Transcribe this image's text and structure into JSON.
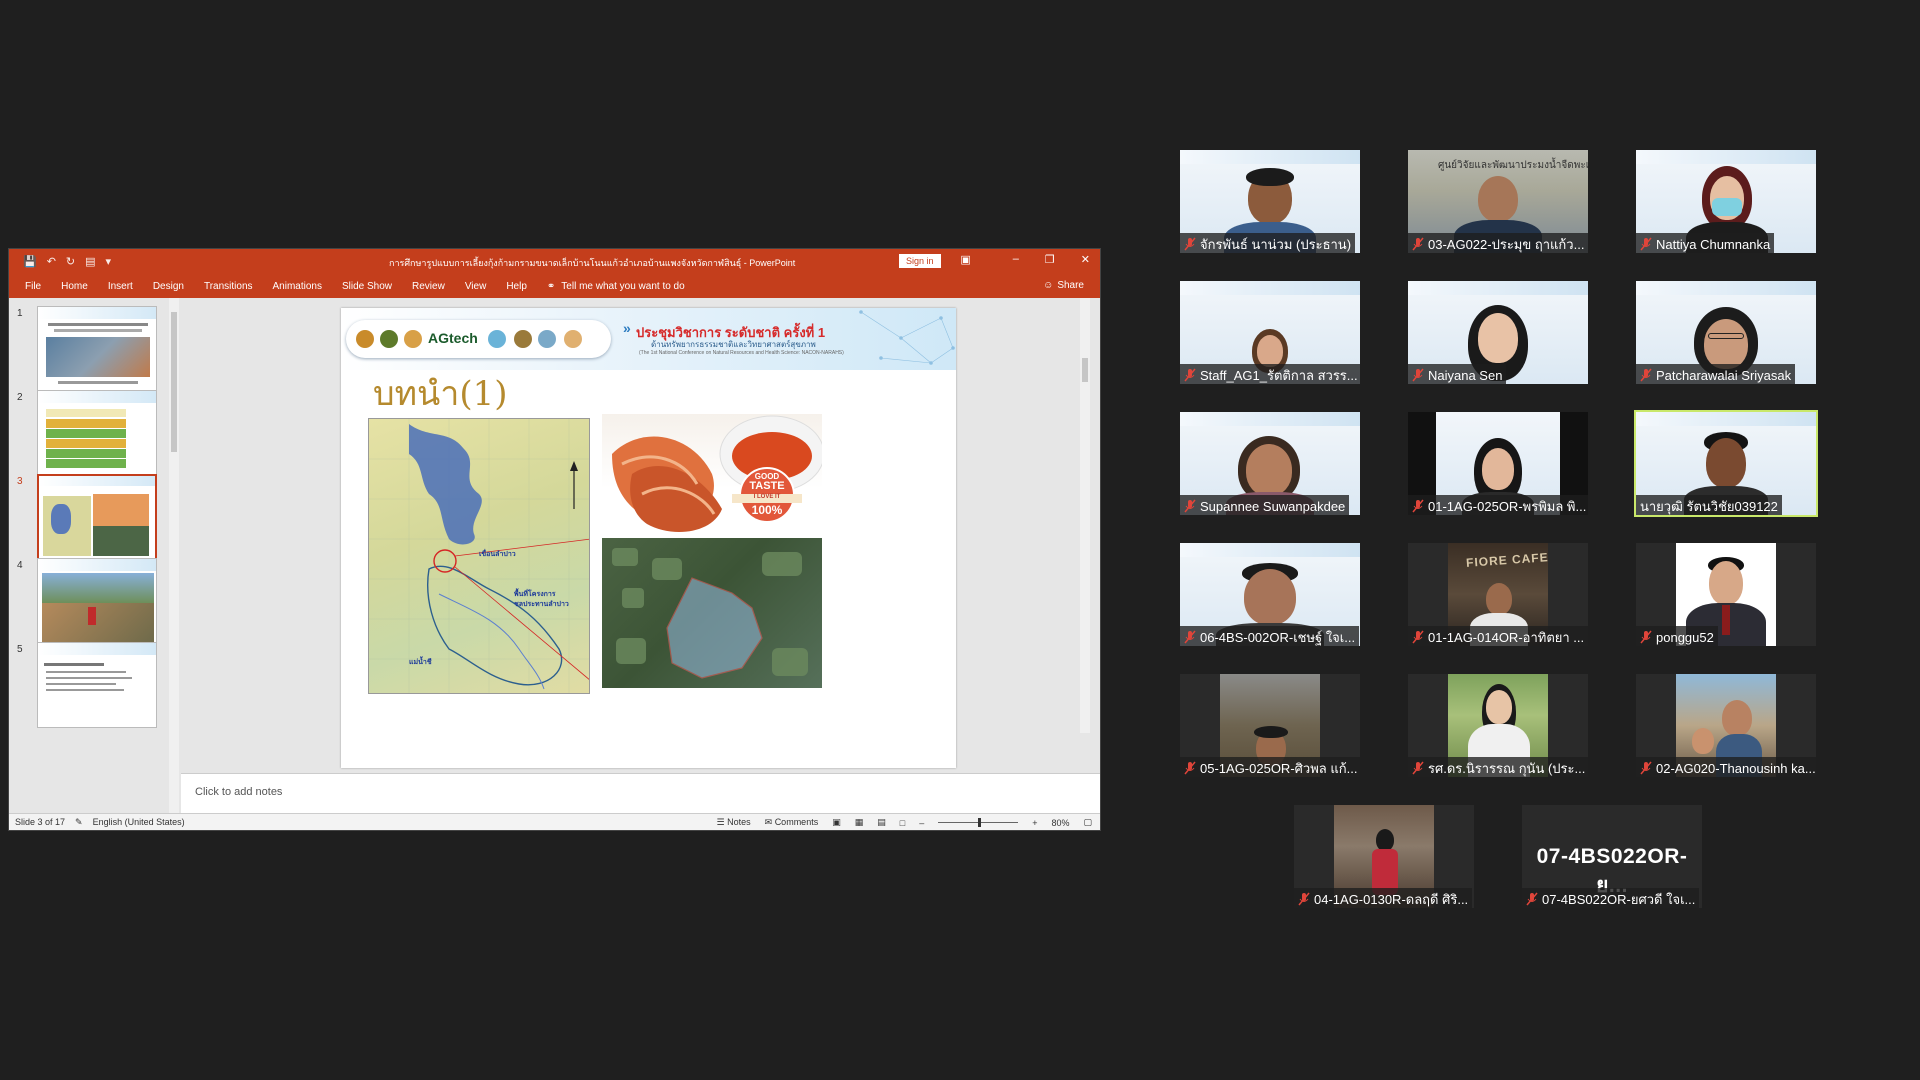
{
  "powerpoint": {
    "doc_title": "การศึกษารูปแบบการเลี้ยงกุ้งก้ามกรามขนาดเล็กบ้านโนนแก้วอำเภอบ้านแพงจังหวัดกาฬสินธุ์ - PowerPoint",
    "sign_in": "Sign in",
    "tabs": [
      "File",
      "Home",
      "Insert",
      "Design",
      "Transitions",
      "Animations",
      "Slide Show",
      "Review",
      "View",
      "Help"
    ],
    "tell_me": "Tell me what you want to do",
    "share": "Share",
    "thumbnail_numbers": [
      "1",
      "2",
      "3",
      "4",
      "5"
    ],
    "current_slide_index": 3,
    "notes_placeholder": "Click to add notes",
    "status": {
      "slide_counter": "Slide 3 of 17",
      "language": "English (United States)",
      "notes": "Notes",
      "comments": "Comments",
      "zoom": "80%"
    },
    "slide": {
      "conference_title": "ประชุมวิชาการ ระดับชาติ ครั้งที่ 1",
      "conference_subtitle": "ด้านทรัพยากรธรรมชาติและวิทยาศาสตร์สุขภาพ",
      "conference_english": "(The 1st National Conference on Natural Resources and Health Science: NACON-NARAHS)",
      "logo_text": "AGtech",
      "heading": "บทนำ(1)",
      "badge_line1": "GOOD",
      "badge_line2": "TASTE",
      "badge_line3": "I LOVE IT",
      "badge_line4": "100%",
      "map_label1": "เขื่อนลำปาว",
      "map_label2": "พื้นที่โครงการ",
      "map_label3": "ชลประทานลำปาว",
      "map_label4": "แม่น้ำชี"
    }
  },
  "participants": [
    "จักรพันธ์ นาน่วม (ประธาน)",
    "03-AG022-ประมุข ฤาแก้ว...",
    "Nattiya Chumnanka",
    "Staff_AG1_รัตติกาล สวรร...",
    "Naiyana Sen",
    "Patcharawalai Sriyasak",
    "Supannee Suwanpakdee",
    "01-1AG-025OR-พรพิมล พิ...",
    "นายวุฒิ รัตนวิชัย039122",
    "06-4BS-002OR-เชษฐ์ ใจเ...",
    "01-1AG-014OR-อาทิตยา ...",
    "ponggu52",
    "05-1AG-025OR-ศิวพล แก้...",
    "รศ.ดร.นิรารรณ กุนัน (ประ...",
    "02-AG020-Thanousinh ka...",
    "04-1AG-0130R-ดลฤดี ศิริ...",
    "07-4BS022OR-ยศวดี ใจเ..."
  ],
  "no_video_label": "07-4BS022OR-ย...",
  "tile_texts": {
    "fiore_cafe": "FIORE CAFE",
    "room_sign": "ศูนย์วิจัยและพัฒนาประมงน้ำจืดพะเยา"
  },
  "colors": {
    "ppt_accent": "#c43e1c",
    "active_speaker": "#c9e86a",
    "mic_muted": "#e0453a"
  }
}
